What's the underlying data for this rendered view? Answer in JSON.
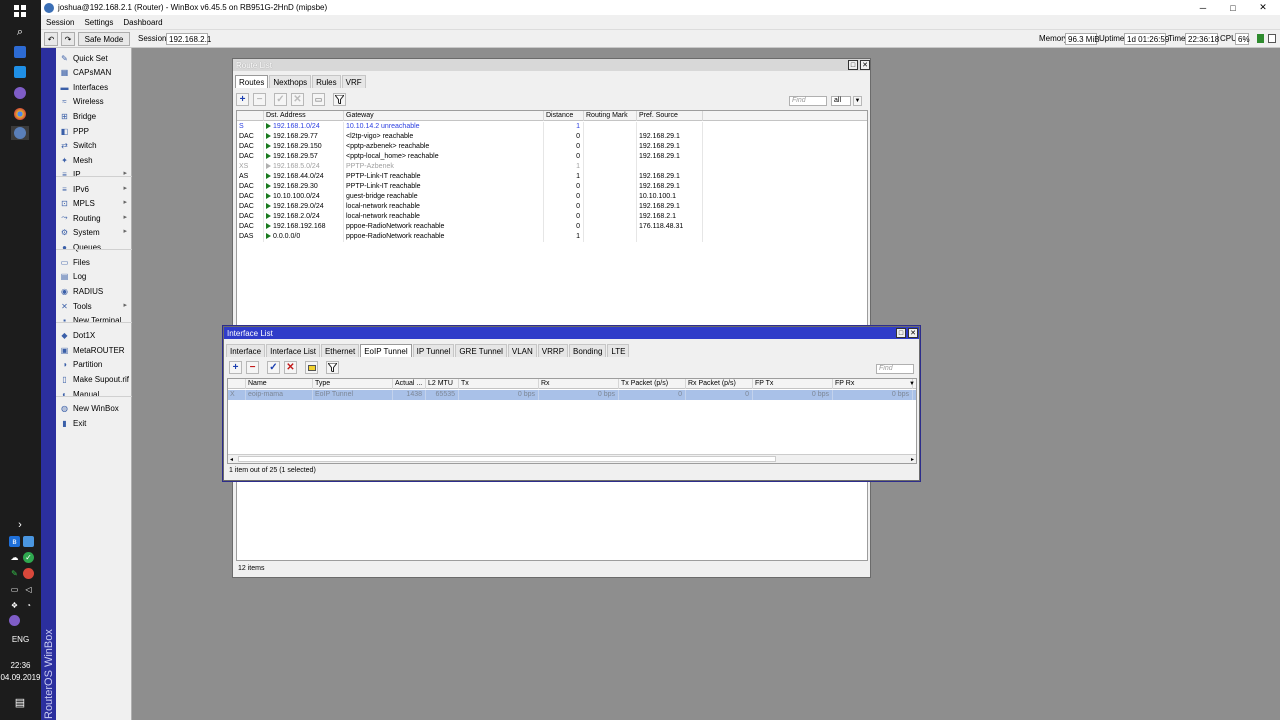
{
  "window": {
    "title": "joshua@192.168.2.1 (Router) - WinBox v6.45.5 on RB951G-2HnD (mipsbe)",
    "minimize": "─",
    "maximize": "□",
    "close": "✕"
  },
  "menu": [
    "Session",
    "Settings",
    "Dashboard"
  ],
  "toolbar": {
    "undo": "↶",
    "redo": "↷",
    "safe_mode": "Safe Mode",
    "session_label": "Session:",
    "session_value": "192.168.2.1",
    "memory_label": "Memory:",
    "memory_value": "96.3 MiB",
    "uptime_label": "Uptime:",
    "uptime_value": "1d 01:26:59",
    "time_label": "Time:",
    "time_value": "22:36:18",
    "cpu_label": "CPU:",
    "cpu_value": "6%"
  },
  "brand": "RouterOS WinBox",
  "sidebar": [
    {
      "label": "Quick Set",
      "icon": "quick-set-icon",
      "glyph": "✎",
      "arrow": false
    },
    {
      "label": "CAPsMAN",
      "icon": "capsman-icon",
      "glyph": "▦",
      "arrow": false
    },
    {
      "label": "Interfaces",
      "icon": "interfaces-icon",
      "glyph": "▬",
      "arrow": false
    },
    {
      "label": "Wireless",
      "icon": "wireless-icon",
      "glyph": "≈",
      "arrow": false
    },
    {
      "label": "Bridge",
      "icon": "bridge-icon",
      "glyph": "⊞",
      "arrow": false
    },
    {
      "label": "PPP",
      "icon": "ppp-icon",
      "glyph": "◧",
      "arrow": false
    },
    {
      "label": "Switch",
      "icon": "switch-icon",
      "glyph": "⇄",
      "arrow": false
    },
    {
      "label": "Mesh",
      "icon": "mesh-icon",
      "glyph": "✦",
      "arrow": false
    },
    {
      "label": "IP",
      "icon": "ip-icon",
      "glyph": "≡",
      "arrow": true
    },
    {
      "label": "IPv6",
      "icon": "ipv6-icon",
      "glyph": "≡",
      "arrow": true
    },
    {
      "label": "MPLS",
      "icon": "mpls-icon",
      "glyph": "⊡",
      "arrow": true
    },
    {
      "label": "Routing",
      "icon": "routing-icon",
      "glyph": "⤳",
      "arrow": true
    },
    {
      "label": "System",
      "icon": "system-icon",
      "glyph": "⚙",
      "arrow": true
    },
    {
      "label": "Queues",
      "icon": "queues-icon",
      "glyph": "●",
      "arrow": false
    },
    {
      "label": "Files",
      "icon": "files-icon",
      "glyph": "▭",
      "arrow": false
    },
    {
      "label": "Log",
      "icon": "log-icon",
      "glyph": "▤",
      "arrow": false
    },
    {
      "label": "RADIUS",
      "icon": "radius-icon",
      "glyph": "◉",
      "arrow": false
    },
    {
      "label": "Tools",
      "icon": "tools-icon",
      "glyph": "✕",
      "arrow": true
    },
    {
      "label": "New Terminal",
      "icon": "terminal-icon",
      "glyph": "▪",
      "arrow": false
    },
    {
      "label": "Dot1X",
      "icon": "dot1x-icon",
      "glyph": "◆",
      "arrow": false
    },
    {
      "label": "MetaROUTER",
      "icon": "metarouter-icon",
      "glyph": "▣",
      "arrow": false
    },
    {
      "label": "Partition",
      "icon": "partition-icon",
      "glyph": "◑",
      "arrow": false
    },
    {
      "label": "Make Supout.rif",
      "icon": "supout-icon",
      "glyph": "▯",
      "arrow": false
    },
    {
      "label": "Manual",
      "icon": "manual-icon",
      "glyph": "◐",
      "arrow": false
    },
    {
      "label": "New WinBox",
      "icon": "winbox-icon",
      "glyph": "◍",
      "arrow": false
    },
    {
      "label": "Exit",
      "icon": "exit-icon",
      "glyph": "▮",
      "arrow": false
    }
  ],
  "route_list": {
    "title": "Route List",
    "tabs": [
      "Routes",
      "Nexthops",
      "Rules",
      "VRF"
    ],
    "find_placeholder": "Find",
    "filter_value": "all",
    "columns": [
      "",
      "Dst. Address",
      "Gateway",
      "Distance",
      "Routing Mark",
      "Pref. Source"
    ],
    "rows": [
      {
        "flags": "S",
        "dst": "192.168.1.0/24",
        "gw": "10.10.14.2 unreachable",
        "dist": "1",
        "mark": "",
        "src": "",
        "style": "blue"
      },
      {
        "flags": "DAC",
        "dst": "192.168.29.77",
        "gw": "<l2tp-vigo> reachable",
        "dist": "0",
        "mark": "",
        "src": "192.168.29.1",
        "style": "normal"
      },
      {
        "flags": "DAC",
        "dst": "192.168.29.150",
        "gw": "<pptp-azbenek> reachable",
        "dist": "0",
        "mark": "",
        "src": "192.168.29.1",
        "style": "normal"
      },
      {
        "flags": "DAC",
        "dst": "192.168.29.57",
        "gw": "<pptp-local_home> reachable",
        "dist": "0",
        "mark": "",
        "src": "192.168.29.1",
        "style": "normal"
      },
      {
        "flags": "XS",
        "dst": "192.168.5.0/24",
        "gw": "PPTP-Azbenek",
        "dist": "1",
        "mark": "",
        "src": "",
        "style": "gray"
      },
      {
        "flags": "AS",
        "dst": "192.168.44.0/24",
        "gw": "PPTP-Link-IT reachable",
        "dist": "1",
        "mark": "",
        "src": "192.168.29.1",
        "style": "normal"
      },
      {
        "flags": "DAC",
        "dst": "192.168.29.30",
        "gw": "PPTP-Link-IT reachable",
        "dist": "0",
        "mark": "",
        "src": "192.168.29.1",
        "style": "normal"
      },
      {
        "flags": "DAC",
        "dst": "10.10.100.0/24",
        "gw": "guest-bridge reachable",
        "dist": "0",
        "mark": "",
        "src": "10.10.100.1",
        "style": "normal"
      },
      {
        "flags": "DAC",
        "dst": "192.168.29.0/24",
        "gw": "local-network reachable",
        "dist": "0",
        "mark": "",
        "src": "192.168.29.1",
        "style": "normal"
      },
      {
        "flags": "DAC",
        "dst": "192.168.2.0/24",
        "gw": "local-network reachable",
        "dist": "0",
        "mark": "",
        "src": "192.168.2.1",
        "style": "normal"
      },
      {
        "flags": "DAC",
        "dst": "192.168.192.168",
        "gw": "pppoe-RadioNetwork reachable",
        "dist": "0",
        "mark": "",
        "src": "176.118.48.31",
        "style": "normal"
      },
      {
        "flags": "DAS",
        "dst": "0.0.0.0/0",
        "gw": "pppoe-RadioNetwork reachable",
        "dist": "1",
        "mark": "",
        "src": "",
        "style": "normal"
      }
    ],
    "status": "12 items"
  },
  "interface_list": {
    "title": "Interface List",
    "tabs": [
      "Interface",
      "Interface List",
      "Ethernet",
      "EoIP Tunnel",
      "IP Tunnel",
      "GRE Tunnel",
      "VLAN",
      "VRRP",
      "Bonding",
      "LTE"
    ],
    "active_tab": 3,
    "find_placeholder": "Find",
    "columns": [
      "",
      "Name",
      "Type",
      "Actual ...",
      "L2 MTU",
      "Tx",
      "Rx",
      "Tx Packet (p/s)",
      "Rx Packet (p/s)",
      "FP Tx",
      "FP Rx"
    ],
    "rows": [
      {
        "flag": "X",
        "name": "eoip-mama",
        "type": "EoIP Tunnel",
        "mtu": "1438",
        "l2mtu": "65535",
        "tx": "0 bps",
        "rx": "0 bps",
        "txp": "0",
        "rxp": "0",
        "fptx": "0 bps",
        "fprx": "0 bps"
      }
    ],
    "status": "1 item out of 25 (1 selected)"
  },
  "taskbar": {
    "lang": "ENG",
    "time": "22:36",
    "date": "04.09.2019"
  }
}
